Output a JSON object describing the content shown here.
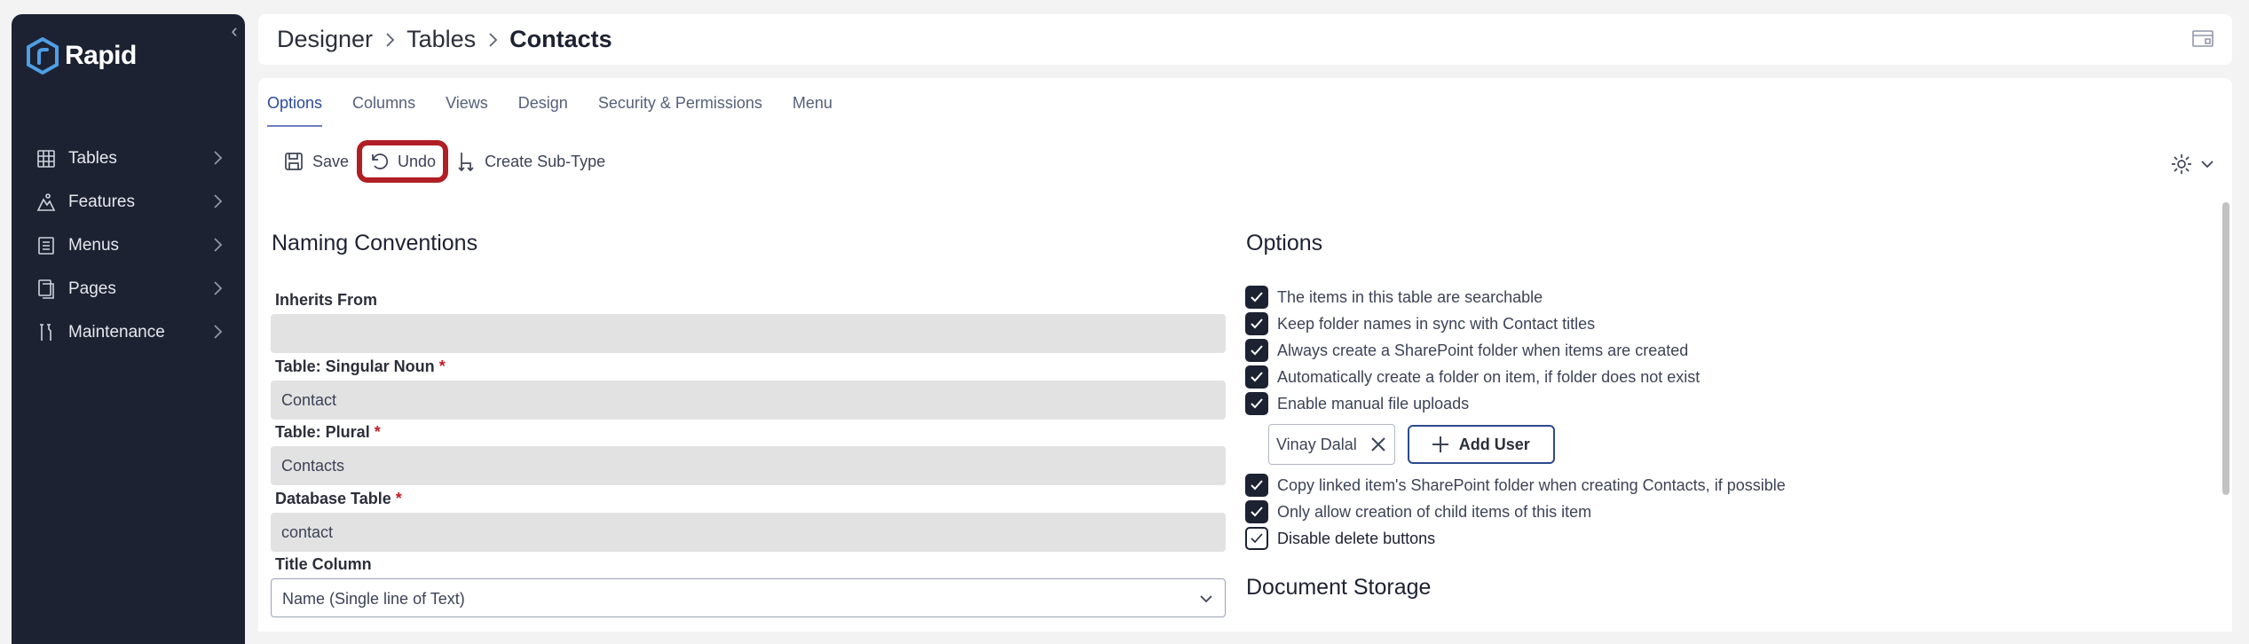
{
  "sidebar": {
    "brand": "Rapid",
    "items": [
      {
        "label": "Tables",
        "icon": "table-icon"
      },
      {
        "label": "Features",
        "icon": "features-icon"
      },
      {
        "label": "Menus",
        "icon": "menu-icon"
      },
      {
        "label": "Pages",
        "icon": "pages-icon"
      },
      {
        "label": "Maintenance",
        "icon": "maintenance-icon"
      }
    ]
  },
  "breadcrumb": [
    "Designer",
    "Tables",
    "Contacts"
  ],
  "tabs": [
    "Options",
    "Columns",
    "Views",
    "Design",
    "Security & Permissions",
    "Menu"
  ],
  "toolbar": {
    "save": "Save",
    "undo": "Undo",
    "create_subtype": "Create Sub-Type"
  },
  "naming": {
    "title": "Naming Conventions",
    "inherits_label": "Inherits From",
    "inherits_value": "",
    "singular_label": "Table: Singular Noun",
    "singular_value": "Contact",
    "plural_label": "Table: Plural",
    "plural_value": "Contacts",
    "db_label": "Database Table",
    "db_value": "contact",
    "title_col_label": "Title Column",
    "title_col_value": "Name (Single line of Text)",
    "required_mark": "*"
  },
  "options": {
    "title": "Options",
    "items": [
      {
        "label": "The items in this table are searchable",
        "checked": true
      },
      {
        "label": "Keep folder names in sync with Contact titles",
        "checked": true
      },
      {
        "label": "Always create a SharePoint folder when items are created",
        "checked": true
      },
      {
        "label": "Automatically create a folder on item, if folder does not exist",
        "checked": true
      },
      {
        "label": "Enable manual file uploads",
        "checked": true
      }
    ],
    "user_chip": "Vinay Dalal",
    "add_user": "Add User",
    "items2": [
      {
        "label": "Copy linked item's SharePoint folder when creating Contacts, if possible",
        "checked": true
      },
      {
        "label": "Only allow creation of child items of this item",
        "checked": true
      },
      {
        "label": "Disable delete buttons",
        "checked": false
      }
    ]
  },
  "document_storage": {
    "title": "Document Storage"
  }
}
